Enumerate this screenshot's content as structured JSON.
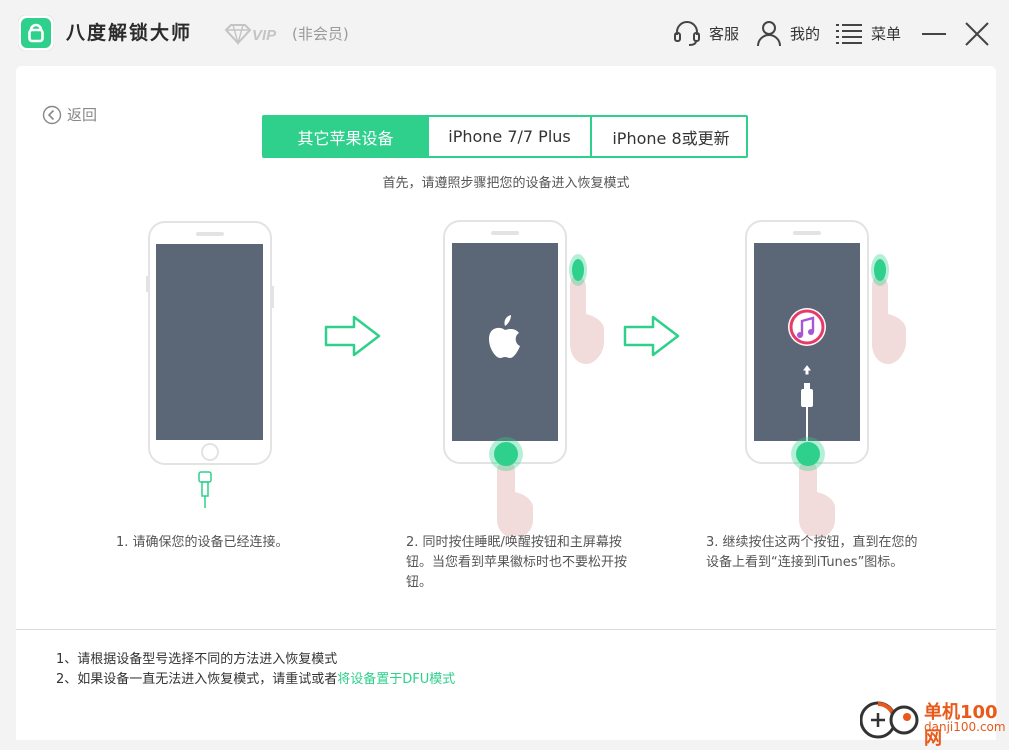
{
  "window": {
    "app_title": "八度解锁大师",
    "vip_label": "VIP",
    "member_status": "(非会员)"
  },
  "titlebar": {
    "support_label": "客服",
    "mine_label": "我的",
    "menu_label": "菜单"
  },
  "main": {
    "back_label": "返回",
    "tabs": [
      {
        "label": "其它苹果设备",
        "active": true
      },
      {
        "label": "iPhone 7/7 Plus",
        "active": false
      },
      {
        "label": "iPhone 8或更新",
        "active": false
      }
    ],
    "subtitle": "首先，请遵照步骤把您的设备进入恢复模式",
    "steps": [
      {
        "lines": [
          "1. 请确保您的设备已经连接。"
        ]
      },
      {
        "lines": [
          "2. 同时按住睡眠/唤醒按钮和主屏幕按",
          "钮。当您看到苹果徽标时也不要松开按",
          "钮。"
        ]
      },
      {
        "lines": [
          "3. 继续按住这两个按钮，直到在您的",
          "设备上看到“连接到iTunes”图标。"
        ]
      }
    ],
    "notes": {
      "note1": "1、请根据设备型号选择不同的方法进入恢复模式",
      "note2_prefix": "2、如果设备一直无法进入恢复模式，请重试或者",
      "note2_link": "将设备置于DFU模式"
    }
  },
  "watermark": {
    "title": "单机100网",
    "url": "danji100.com"
  },
  "colors": {
    "accent": "#2ed08c",
    "screen": "#5b6776",
    "watermark": "#e8591a"
  },
  "icons": [
    "logo-icon",
    "vip-diamond-icon",
    "headset-icon",
    "user-icon",
    "menu-icon",
    "minimize-icon",
    "close-icon",
    "back-arrow-icon",
    "arrow-right-icon",
    "apple-icon",
    "itunes-icon",
    "usb-cable-icon",
    "finger-press-icon"
  ]
}
